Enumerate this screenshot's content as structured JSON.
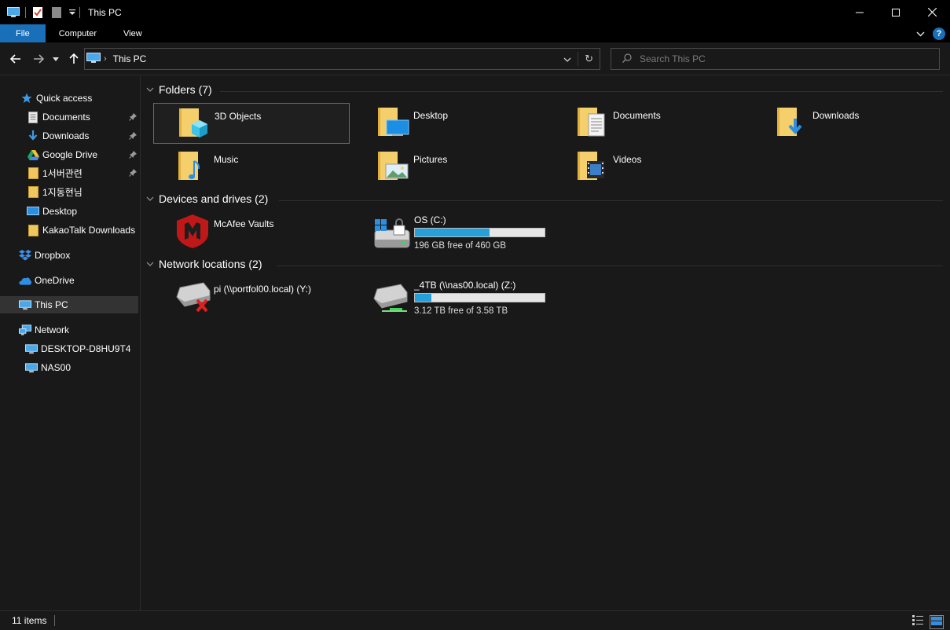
{
  "window": {
    "title": "This PC",
    "controls": {
      "minimize": "—",
      "maximize": "☐",
      "close": "✕"
    }
  },
  "ribbon": {
    "tabs": [
      {
        "label": "File"
      },
      {
        "label": "Computer"
      },
      {
        "label": "View"
      }
    ],
    "help": "?"
  },
  "address": {
    "location": "This PC",
    "search_placeholder": "Search This PC"
  },
  "sidebar": {
    "items": [
      {
        "label": "Quick access",
        "icon": "star-icon",
        "pinned": false
      },
      {
        "label": "Documents",
        "icon": "documents-icon",
        "pinned": true
      },
      {
        "label": "Downloads",
        "icon": "download-arrow-icon",
        "pinned": true
      },
      {
        "label": "Google Drive",
        "icon": "google-drive-icon",
        "pinned": true
      },
      {
        "label": "1서버관련",
        "icon": "folder-icon",
        "pinned": true
      },
      {
        "label": "1지동현님",
        "icon": "folder-icon",
        "pinned": false
      },
      {
        "label": "Desktop",
        "icon": "desktop-icon",
        "pinned": false
      },
      {
        "label": "KakaoTalk Downloads",
        "icon": "folder-icon",
        "pinned": false
      },
      {
        "label": "Dropbox",
        "icon": "dropbox-icon",
        "pinned": false
      },
      {
        "label": "OneDrive",
        "icon": "cloud-icon",
        "pinned": false
      },
      {
        "label": "This PC",
        "icon": "computer-icon",
        "pinned": false,
        "selected": true
      },
      {
        "label": "Network",
        "icon": "network-icon",
        "pinned": false
      },
      {
        "label": "DESKTOP-D8HU9T4",
        "icon": "monitor-icon",
        "pinned": false
      },
      {
        "label": "NAS00",
        "icon": "monitor-icon",
        "pinned": false
      }
    ]
  },
  "groups": {
    "folders": {
      "label": "Folders (7)",
      "items": [
        {
          "name": "3D Objects",
          "icon": "3d-objects-folder-icon",
          "selected": true
        },
        {
          "name": "Desktop",
          "icon": "desktop-folder-icon"
        },
        {
          "name": "Documents",
          "icon": "documents-folder-icon"
        },
        {
          "name": "Downloads",
          "icon": "downloads-folder-icon"
        },
        {
          "name": "Music",
          "icon": "music-folder-icon"
        },
        {
          "name": "Pictures",
          "icon": "pictures-folder-icon"
        },
        {
          "name": "Videos",
          "icon": "videos-folder-icon"
        }
      ]
    },
    "devices": {
      "label": "Devices and drives (2)",
      "items": [
        {
          "name": "McAfee Vaults",
          "icon": "mcafee-shield-icon"
        },
        {
          "name": "OS (C:)",
          "icon": "windows-drive-icon",
          "free": "196 GB free of 460 GB",
          "used_fraction": 0.574
        }
      ]
    },
    "network": {
      "label": "Network locations (2)",
      "items": [
        {
          "name": "pi (\\\\portfol00.local) (Y:)",
          "icon": "disconnected-network-drive-icon"
        },
        {
          "name": "_4TB (\\\\nas00.local) (Z:)",
          "icon": "network-drive-icon",
          "free": "3.12 TB free of 3.58 TB",
          "used_fraction": 0.128
        }
      ]
    }
  },
  "status": {
    "count": "11 items"
  },
  "colors": {
    "accent": "#1a6fb9",
    "progress": "#26a0da",
    "background": "#191919",
    "titlebar": "#000000",
    "folder": "#f0c75e"
  }
}
